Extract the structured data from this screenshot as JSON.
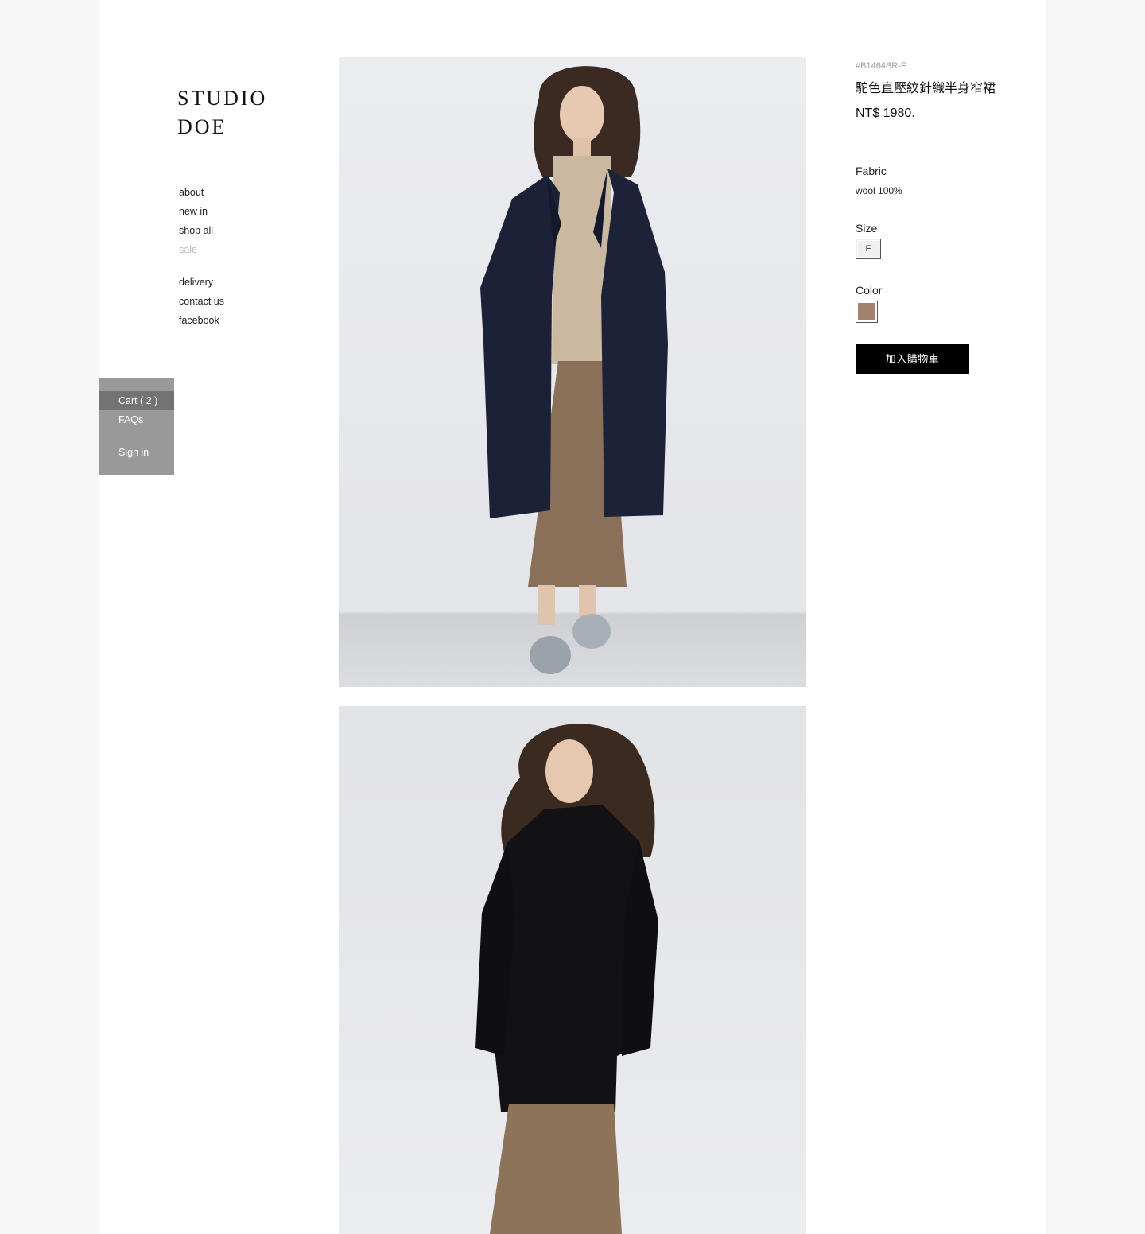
{
  "brand": {
    "line1": "STUDIO",
    "line2": "DOE"
  },
  "nav": {
    "primary": [
      {
        "label": "about"
      },
      {
        "label": "new in"
      },
      {
        "label": "shop all"
      },
      {
        "label": "sale"
      }
    ],
    "secondary": [
      {
        "label": "delivery"
      },
      {
        "label": "contact us"
      },
      {
        "label": "facebook"
      }
    ]
  },
  "account_panel": {
    "cart_label": "Cart ( 2 )",
    "faqs_label": "FAQs",
    "signin_label": "Sign in"
  },
  "product": {
    "sku": "#B1464BR-F",
    "title": "駝色直壓紋針織半身窄裙",
    "price": "NT$ 1980.",
    "fabric_label": "Fabric",
    "fabric_value": "wool 100%",
    "size_label": "Size",
    "size_value": "F",
    "color_label": "Color",
    "color_swatch": "#a0826d",
    "add_to_cart_label": "加入購物車"
  },
  "colors": {
    "panel_bg": "#999999",
    "panel_active": "#737373",
    "muted_link": "#b9b9b9",
    "button_bg": "#000000"
  }
}
